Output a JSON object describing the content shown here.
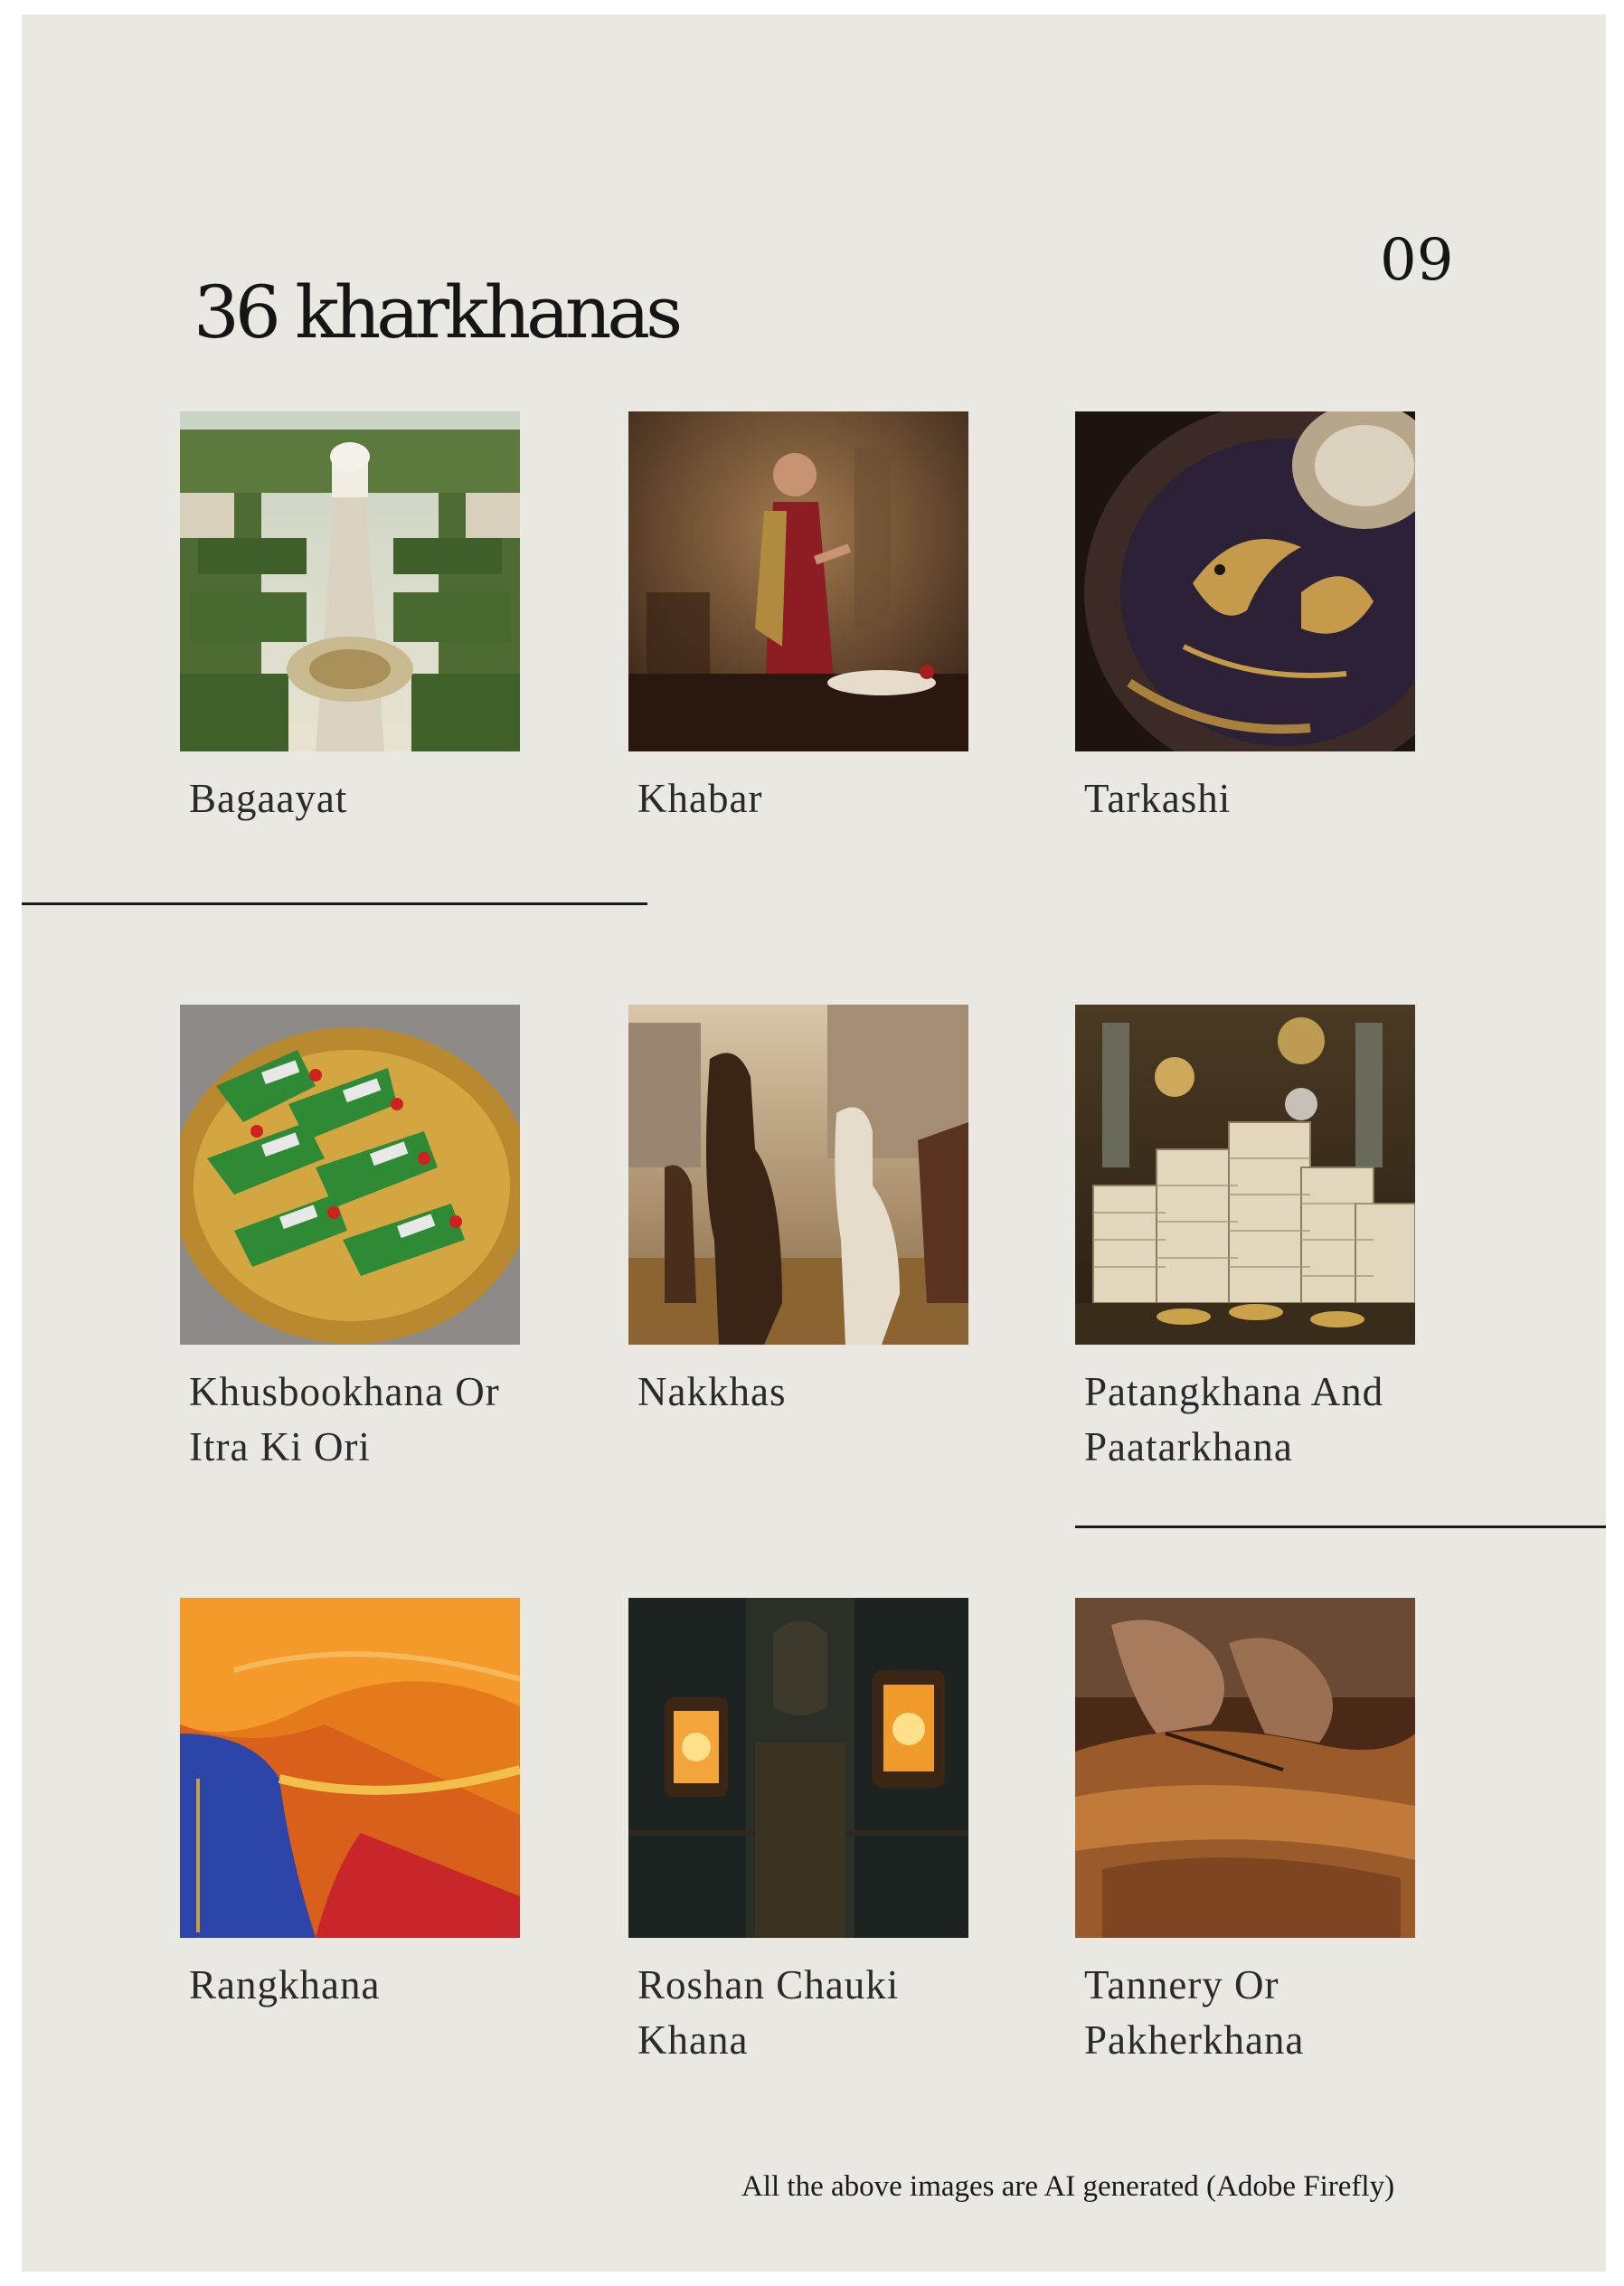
{
  "page": {
    "title": "36 kharkhanas",
    "number": "09",
    "footnote": "All the above images are AI generated (Adobe Firefly)"
  },
  "items": [
    {
      "caption": "Bagaayat",
      "icon": "mughal-garden-image"
    },
    {
      "caption": "Khabar",
      "icon": "messenger-man-image"
    },
    {
      "caption": "Tarkashi",
      "icon": "inlaid-vase-image"
    },
    {
      "caption": "Khusbookhana Or Itra Ki Ori",
      "icon": "paan-platter-image"
    },
    {
      "caption": "Nakkhas",
      "icon": "horses-image"
    },
    {
      "caption": "Patangkhana And Paatarkhana",
      "icon": "paper-stacks-image"
    },
    {
      "caption": "Rangkhana",
      "icon": "silk-fabric-image"
    },
    {
      "caption": "Roshan Chauki Khana",
      "icon": "wall-lanterns-image"
    },
    {
      "caption": "Tannery Or Pakherkhana",
      "icon": "leather-work-image"
    }
  ],
  "colors": {
    "page_background": "#eae8e2",
    "text": "#151515"
  }
}
